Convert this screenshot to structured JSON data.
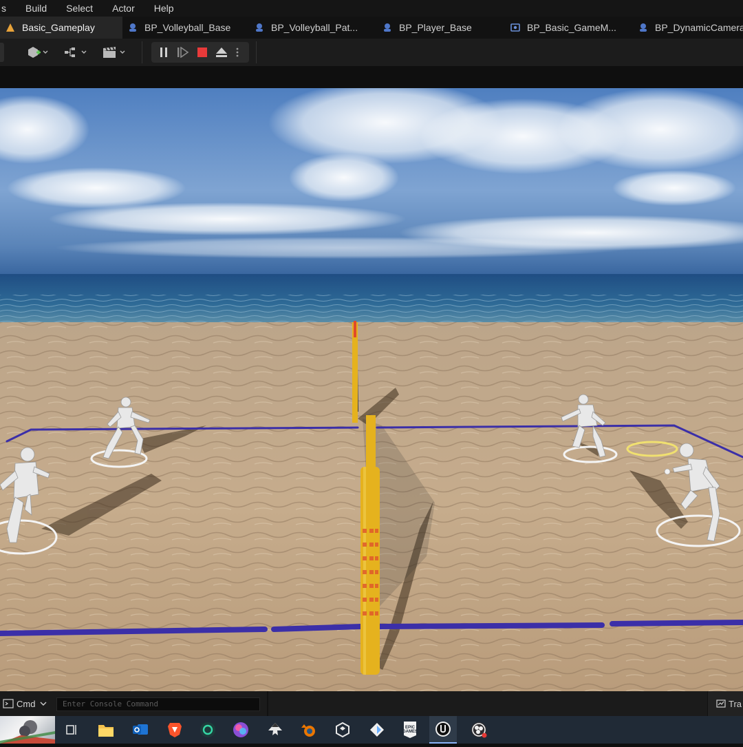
{
  "menu": {
    "items": [
      "s",
      "Build",
      "Select",
      "Actor",
      "Help"
    ]
  },
  "tabs": [
    {
      "label": "Basic_Gameplay",
      "icon": "level-icon",
      "active": true
    },
    {
      "label": "BP_Volleyball_Base",
      "icon": "blueprint-icon",
      "active": false
    },
    {
      "label": "BP_Volleyball_Pat...",
      "icon": "blueprint-icon",
      "active": false
    },
    {
      "label": "BP_Player_Base",
      "icon": "blueprint-icon",
      "active": false
    },
    {
      "label": "BP_Basic_GameM...",
      "icon": "gamemode-icon",
      "active": false
    },
    {
      "label": "BP_DynamicCamera",
      "icon": "blueprint-icon",
      "active": false
    }
  ],
  "toolbar": {
    "add_icon": "add-actor-icon",
    "blueprint_icon": "blueprint-menu-icon",
    "cinematics_icon": "clapperboard-icon",
    "pause_icon": "pause-icon",
    "advance_icon": "frame-advance-icon",
    "stop_icon": "stop-icon",
    "eject_icon": "eject-icon",
    "more_icon": "more-options-icon",
    "stop_color": "#e83a3a"
  },
  "viewport": {
    "scene": "beach volleyball court",
    "line_color": "#3b2fa8",
    "pole_color": "#e5b21e"
  },
  "statusbar": {
    "cmd_label": "Cmd",
    "console_placeholder": "Enter Console Command",
    "right_label": "Tra"
  },
  "taskbar": {
    "icons": [
      "task-view-icon",
      "file-explorer-icon",
      "outlook-icon",
      "brave-icon",
      "app-icon",
      "color-app-icon",
      "inkscape-icon",
      "blender-icon",
      "unity-icon",
      "app-diamond-icon",
      "epic-games-icon",
      "unreal-engine-icon",
      "obs-icon"
    ],
    "epic_label": "EPIC\nGAMES"
  }
}
